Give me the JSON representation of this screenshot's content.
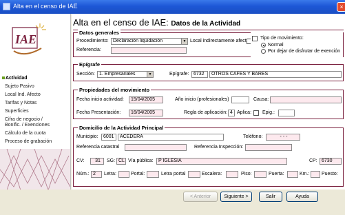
{
  "window": {
    "title": "Alta en el censo de IAE",
    "close": "×"
  },
  "sidebar": {
    "logo_text": "IAE",
    "items": [
      {
        "label": "Actividad",
        "active": true
      },
      {
        "label": "Sujeto Pasivo"
      },
      {
        "label": "Local Ind. Afecto"
      },
      {
        "label": "Tarifas y Notas"
      },
      {
        "label": "Superficies"
      },
      {
        "label": "Cifra de negocio /"
      },
      {
        "label": "Bonific. / Exenciones"
      },
      {
        "label": "Cálculo de la cuota"
      },
      {
        "label": "Proceso de grabación"
      }
    ]
  },
  "header": {
    "title": "Alta en el censo de IAE:",
    "subtitle": "Datos de la Actividad"
  },
  "datos_generales": {
    "legend": "Datos generales",
    "procedimiento_label": "Procedimiento:",
    "procedimiento_value": "Declaración liquidación",
    "local_label": "Local indirectamente afecto",
    "referencia_label": "Referencia:",
    "referencia_value": "",
    "tipo_label": "Tipo de movimiento:",
    "tipo_options": [
      "Normal",
      "Por dejar de disfrutar de exención"
    ]
  },
  "epigrafe": {
    "legend": "Epígrafe",
    "seccion_label": "Sección:",
    "seccion_value": "1. Empresariales",
    "epigrafe_label": "Epígrafe:",
    "epigrafe_code": "6732",
    "epigrafe_desc": "OTROS CAFES Y BARES"
  },
  "propiedades": {
    "legend": "Propiedades del movimiento",
    "fecha_inicio_label": "Fecha inicio actividad:",
    "fecha_inicio_value": "15/04/2005",
    "anio_inicio_label": "Año inicio (profesionales)",
    "anio_inicio_value": "",
    "causa_label": "Causa:",
    "causa_value": "",
    "fecha_pres_label": "Fecha Presentación:",
    "fecha_pres_value": "16/04/2005",
    "regla_label": "Regla de aplicación:",
    "regla_value": "4",
    "aplica_label": "Aplica:",
    "epig_label": "Epig.:",
    "epig_value": ""
  },
  "domicilio": {
    "legend": "Domicilio de la Actividad Principal",
    "municipio_label": "Municipio:",
    "municipio_code": "6001",
    "municipio_name": "ACEDERA",
    "telefono_label": "Teléfono:",
    "telefono_value": "- - -",
    "ref_catastral_label": "Referencia catastral",
    "ref_catastral_value": "",
    "ref_inspeccion_label": "Referencia Inspección:",
    "ref_inspeccion_value": "",
    "cv_label": "CV:",
    "cv_value": "31",
    "sg_label": "SG:",
    "sg_value": "CL",
    "via_label": "Vía pública:",
    "via_value": "P IGLESIA",
    "cp_label": "CP:",
    "cp_value": "6730",
    "num_label": "Núm.:",
    "num_value": "2",
    "letra_label": "Letra:",
    "portal_label": "Portal:",
    "letra_portal_label": "Letra portal",
    "escalera_label": "Escalera:",
    "piso_label": "Piso:",
    "puerta_label": "Puerta:",
    "km_label": "Km.:",
    "puesto_label": "Puesto:"
  },
  "buttons": {
    "anterior": "< Anterior",
    "siguiente": "Siguiente >",
    "salir": "Salir",
    "ayuda": "Ayuda"
  }
}
